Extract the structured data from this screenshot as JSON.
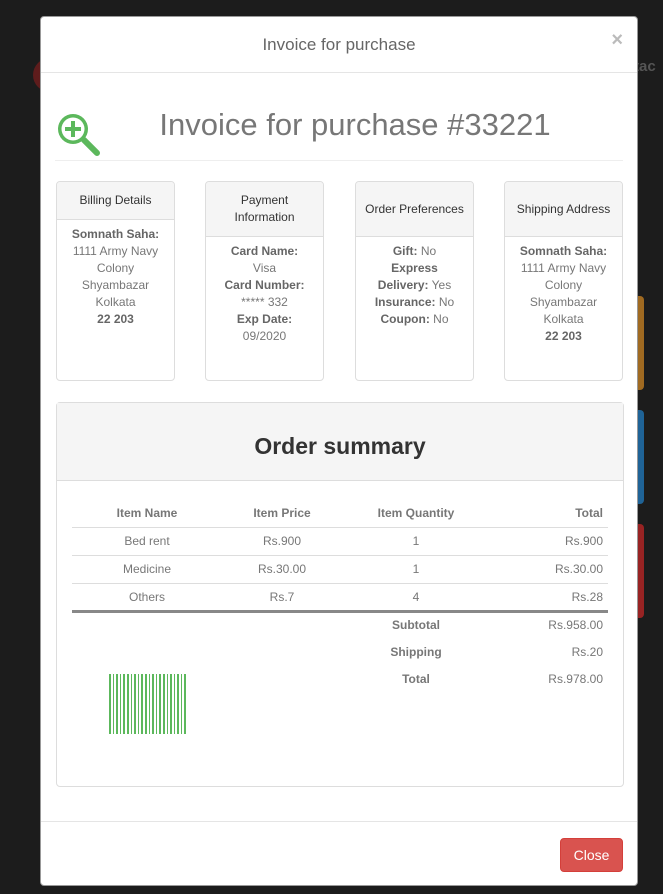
{
  "background": {
    "partial_text": "tac"
  },
  "modal": {
    "title": "Invoice for purchase",
    "close_symbol": "×",
    "invoice_title": "Invoice for purchase #33221"
  },
  "billing": {
    "header": "Billing Details",
    "name": "Somnath Saha:",
    "line1": "1111 Army Navy",
    "line2": "Colony",
    "line3": "Shyambazar",
    "line4": "Kolkata",
    "zip": "22 203"
  },
  "payment": {
    "header": "Payment Information",
    "card_name_label": "Card Name:",
    "card_name": "Visa",
    "card_number_label": "Card Number:",
    "card_number": "***** 332",
    "exp_label": "Exp Date:",
    "exp": "09/2020"
  },
  "preferences": {
    "header": "Order Preferences",
    "gift_label": "Gift:",
    "gift": "No",
    "express_label": "Express",
    "delivery_label": "Delivery:",
    "delivery": "Yes",
    "insurance_label": "Insurance:",
    "insurance": "No",
    "coupon_label": "Coupon:",
    "coupon": "No"
  },
  "shipping": {
    "header": "Shipping Address",
    "name": "Somnath Saha:",
    "line1": "1111 Army Navy",
    "line2": "Colony",
    "line3": "Shyambazar",
    "line4": "Kolkata",
    "zip": "22 203"
  },
  "summary": {
    "title": "Order summary",
    "columns": [
      "Item Name",
      "Item Price",
      "Item Quantity",
      "Total"
    ],
    "rows": [
      [
        "Bed rent",
        "Rs.900",
        "1",
        "Rs.900"
      ],
      [
        "Medicine",
        "Rs.30.00",
        "1",
        "Rs.30.00"
      ],
      [
        "Others",
        "Rs.7",
        "4",
        "Rs.28"
      ]
    ],
    "subtotal_label": "Subtotal",
    "subtotal": "Rs.958.00",
    "shipping_label": "Shipping",
    "shipping": "Rs.20",
    "total_label": "Total",
    "total": "Rs.978.00"
  },
  "footer": {
    "close_label": "Close"
  },
  "colors": {
    "accent_green": "#5cb85c",
    "danger": "#d9534f"
  }
}
